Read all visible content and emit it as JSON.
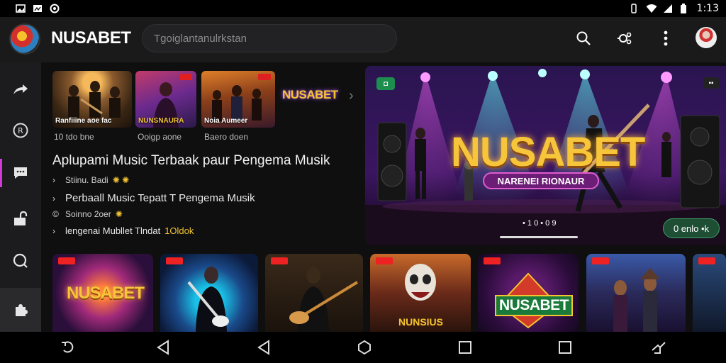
{
  "status_bar": {
    "time": "1:13",
    "left_icons": [
      "image-icon",
      "gallery-icon",
      "sync-icon"
    ],
    "right_icons": [
      "vibrate-icon",
      "wifi-icon",
      "signal-icon",
      "battery-icon"
    ]
  },
  "app_bar": {
    "brand": "NUSABET",
    "search_placeholder": "Tgoiglantanulrkstan",
    "actions": [
      "search-icon",
      "tune-icon",
      "more-vert-icon",
      "profile-avatar"
    ]
  },
  "side_rail": {
    "items": [
      "share-icon",
      "radio-icon",
      "chat-icon",
      "lock-open-icon",
      "search-icon",
      "puzzle-icon"
    ]
  },
  "thumbnails": [
    {
      "caption": "Ranfiiine aoe fac",
      "sub": "10 tdo bne"
    },
    {
      "caption": "NUNSNAURA",
      "sub": "Ooigp aone"
    },
    {
      "caption": "Noia Aumeer",
      "sub": "Baero doen"
    }
  ],
  "mini_logo": "NUSABET",
  "description": {
    "headline": "Aplupami Music Terbaak paur Pengema Musik",
    "line1": "Stiinu. Badi",
    "line2": "Perbaall Music Tepatt T Pengema Musik",
    "line3": "Soinno 2oer",
    "line4_text": "lengenai Mubllet Tlndat",
    "line4_highlight": "1Oldok"
  },
  "hero": {
    "title": "NUSABET",
    "pill": "NARENEI RIONAUR",
    "tag_left": "◘",
    "tag_right": "▪▪",
    "dots": "• 1 0 • 0 9",
    "button": "0 enlo •k"
  },
  "cards": [
    {
      "label": "NUSABET"
    },
    {
      "label": ""
    },
    {
      "label": ""
    },
    {
      "label": "NUNSIUS"
    },
    {
      "label": "NUSABET"
    },
    {
      "label": ""
    },
    {
      "label": ""
    }
  ],
  "nav_bar": [
    "back-icon",
    "triangle-back-icon",
    "triangle-back-icon-2",
    "home-hexagon-icon",
    "recents-square-icon",
    "recents-square-icon-2",
    "assistant-icon"
  ],
  "colors": {
    "accent": "#d23ad8",
    "gold": "#f4c431",
    "background": "#0f0f10"
  }
}
